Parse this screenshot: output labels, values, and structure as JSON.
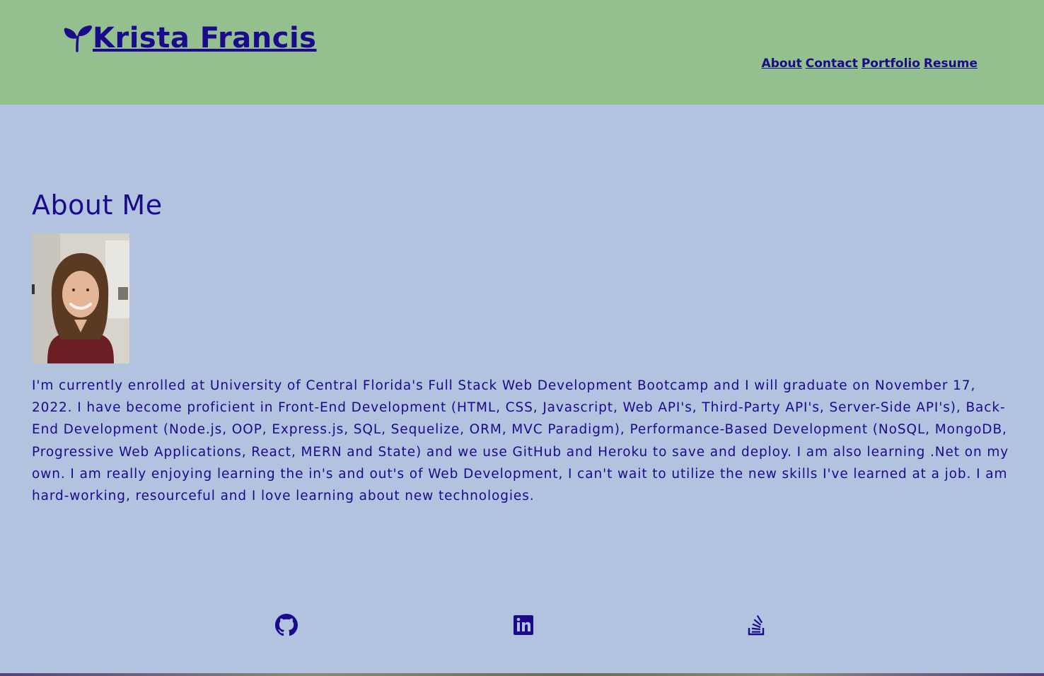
{
  "header": {
    "brand_icon": "seedling-icon",
    "brand_name": "Krista Francis",
    "nav": [
      "About",
      "Contact",
      "Portfolio",
      "Resume"
    ]
  },
  "about": {
    "heading": "About Me",
    "photo_icon": "profile-photo",
    "bio": "I'm currently enrolled at University of Central Florida's Full Stack Web Development Bootcamp and I will graduate on November 17, 2022. I have become proficient in Front-End Development (HTML, CSS, Javascript, Web API's, Third-Party API's, Server-Side API's), Back-End Development (Node.js, OOP, Express.js, SQL, Sequelize, ORM, MVC Paradigm), Performance-Based Development (NoSQL, MongoDB, Progressive Web Applications, React, MERN and State) and we use GitHub and Heroku to save and deploy. I am also learning .Net on my own. I am really enjoying learning the in's and out's of Web Development, I can't wait to utilize the new skills I've learned at a job. I am hard-working, resourceful and I love learning about new technologies."
  },
  "footer": {
    "icons": [
      "github-icon",
      "linkedin-icon",
      "stack-overflow-icon"
    ]
  },
  "colors": {
    "header_bg": "#93c08e",
    "page_bg": "#b2c3df",
    "text": "#1c0a8c"
  }
}
